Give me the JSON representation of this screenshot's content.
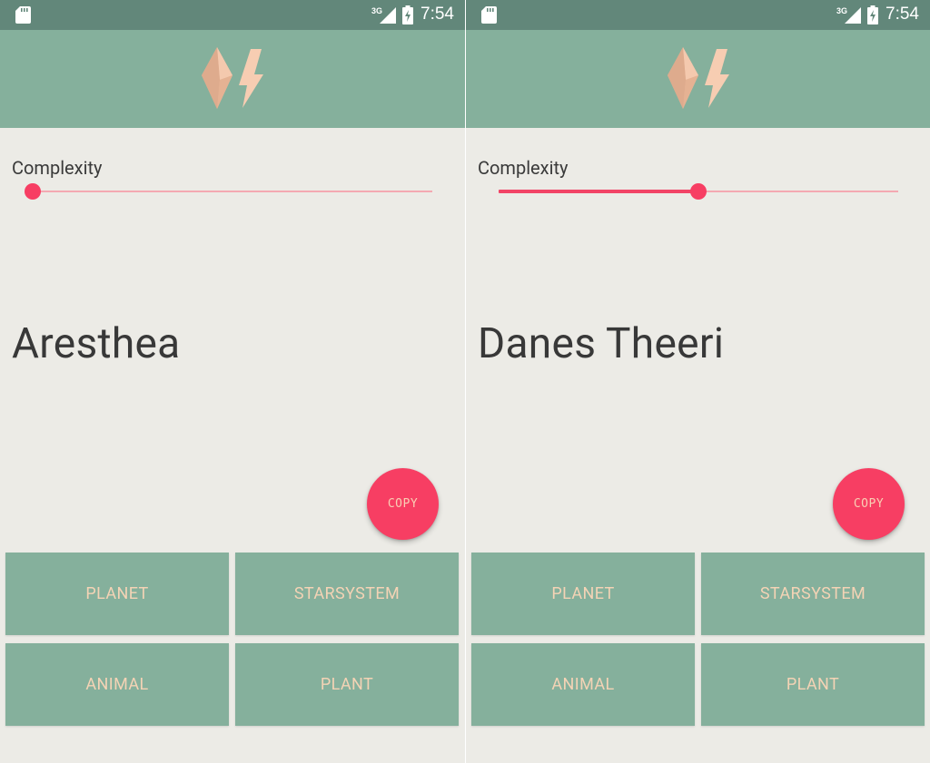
{
  "colors": {
    "status_bar": "#62877a",
    "app_bar": "#85b09c",
    "background": "#ecebe6",
    "accent": "#f73e63",
    "button_text": "#f4d3b5",
    "slider_track": "#f4a9b2"
  },
  "screens": [
    {
      "status_bar": {
        "time": "7:54",
        "network": "3G",
        "icons": [
          "sd-card-icon",
          "signal-3g-icon",
          "battery-charging-icon"
        ]
      },
      "app_bar": {
        "logo": "crystal-lightning-logo"
      },
      "complexity": {
        "label": "Complexity",
        "level": 0.0
      },
      "generated_name": "Aresthea",
      "copy_button": {
        "label": "COPY"
      },
      "buttons": {
        "planet": "PLANET",
        "starsystem": "STARSYSTEM",
        "animal": "ANIMAL",
        "plant": "PLANT"
      }
    },
    {
      "status_bar": {
        "time": "7:54",
        "network": "3G",
        "icons": [
          "sd-card-icon",
          "signal-3g-icon",
          "battery-charging-icon"
        ]
      },
      "app_bar": {
        "logo": "crystal-lightning-logo"
      },
      "complexity": {
        "label": "Complexity",
        "level": 0.5
      },
      "generated_name": "Danes Theeri",
      "copy_button": {
        "label": "COPY"
      },
      "buttons": {
        "planet": "PLANET",
        "starsystem": "STARSYSTEM",
        "animal": "ANIMAL",
        "plant": "PLANT"
      }
    }
  ]
}
